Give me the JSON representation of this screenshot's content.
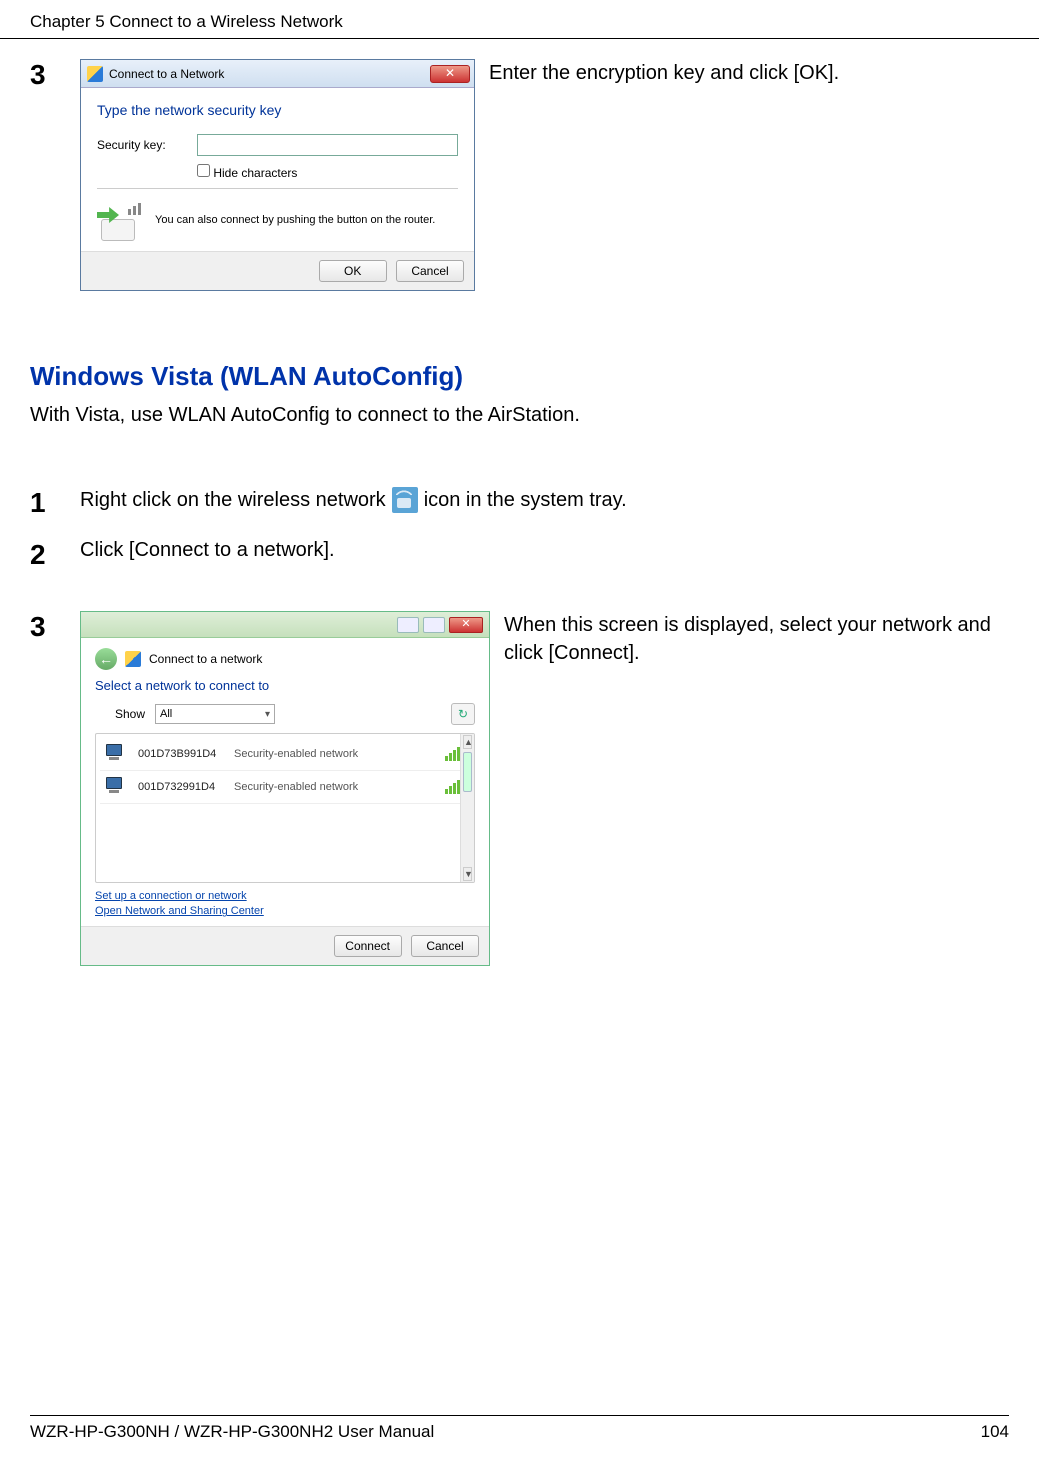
{
  "header": {
    "chapter": "Chapter 5  Connect to a Wireless Network"
  },
  "step3_win7": {
    "num": "3",
    "instruction": "Enter the encryption key and click [OK].",
    "dialog": {
      "title": "Connect to a Network",
      "heading": "Type the network security key",
      "securityLabel": "Security key:",
      "hideChars": "Hide characters",
      "pushText": "You can also connect by pushing the button on the router.",
      "ok": "OK",
      "cancel": "Cancel"
    }
  },
  "vista_section": {
    "heading": "Windows Vista (WLAN AutoConfig)",
    "intro": "With Vista, use WLAN AutoConfig to connect to the AirStation."
  },
  "vista_step1": {
    "num": "1",
    "before": "Right click on the wireless network",
    "after": "icon in the system tray."
  },
  "vista_step2": {
    "num": "2",
    "text": "Click [Connect to a network]."
  },
  "vista_step3": {
    "num": "3",
    "instruction": "When this screen is displayed, select your network and click [Connect].",
    "dialog": {
      "title": "Connect to a network",
      "heading": "Select a network to connect to",
      "showLabel": "Show",
      "showValue": "All",
      "networks": [
        {
          "name": "001D73B991D4",
          "status": "Security-enabled network"
        },
        {
          "name": "001D732991D4",
          "status": "Security-enabled network"
        }
      ],
      "link1": "Set up a connection or network",
      "link2": "Open Network and Sharing Center",
      "connect": "Connect",
      "cancel": "Cancel"
    }
  },
  "footer": {
    "manual": "WZR-HP-G300NH / WZR-HP-G300NH2 User Manual",
    "page": "104"
  }
}
